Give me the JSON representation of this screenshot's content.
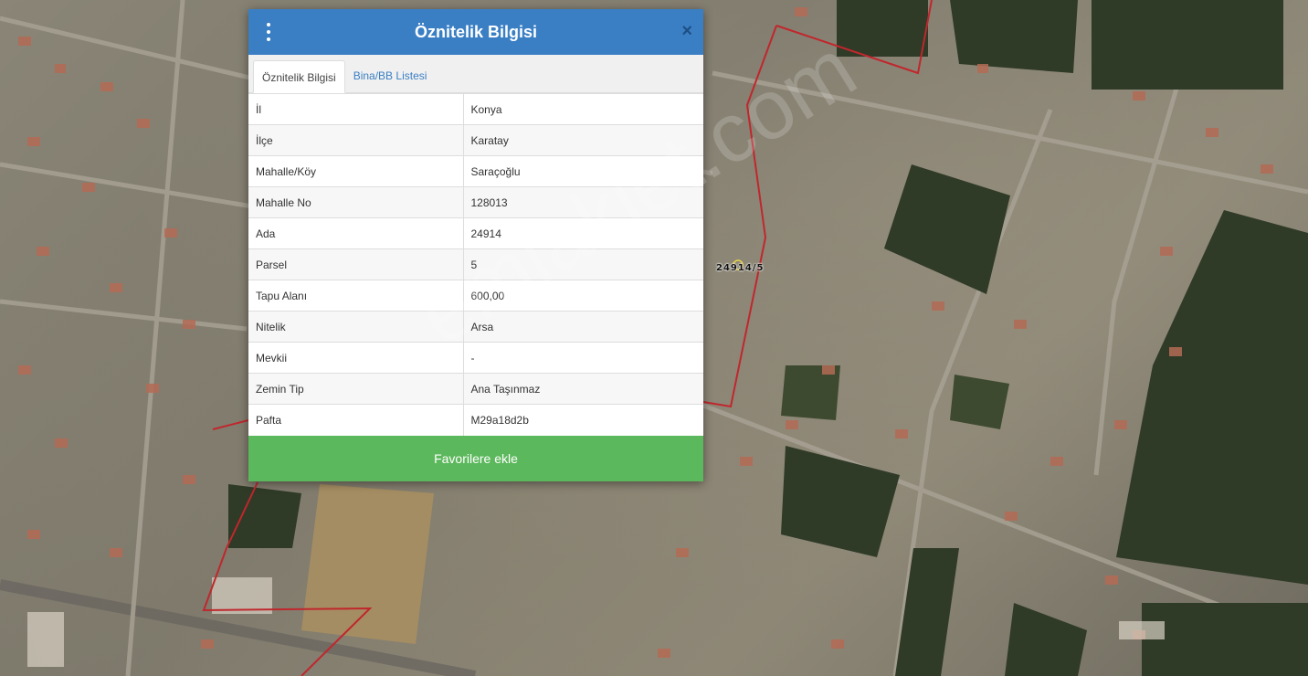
{
  "dialog": {
    "title": "Öznitelik Bilgisi",
    "menu_icon": "vertical-dots-icon",
    "close_icon": "close-icon",
    "close_glyph": "×",
    "tabs": [
      {
        "label": "Öznitelik Bilgisi",
        "active": true
      },
      {
        "label": "Bina/BB Listesi",
        "active": false
      }
    ],
    "rows": [
      {
        "key": "İl",
        "value": "Konya"
      },
      {
        "key": "İlçe",
        "value": "Karatay"
      },
      {
        "key": "Mahalle/Köy",
        "value": "Saraçoğlu"
      },
      {
        "key": "Mahalle No",
        "value": "128013"
      },
      {
        "key": "Ada",
        "value": "24914"
      },
      {
        "key": "Parsel",
        "value": "5"
      },
      {
        "key": "Tapu Alanı",
        "value": "600,00"
      },
      {
        "key": "Nitelik",
        "value": "Arsa"
      },
      {
        "key": "Mevkii",
        "value": "-"
      },
      {
        "key": "Zemin Tip",
        "value": "Ana Taşınmaz"
      },
      {
        "key": "Pafta",
        "value": "M29a18d2b"
      }
    ],
    "favorite_button": "Favorilere ekle"
  },
  "map": {
    "parcel_label": "24914/5",
    "watermark": "emlakjet.com",
    "boundary_color": "#c0272d",
    "header_color": "#3a7fc4",
    "button_color": "#5cb85c"
  }
}
